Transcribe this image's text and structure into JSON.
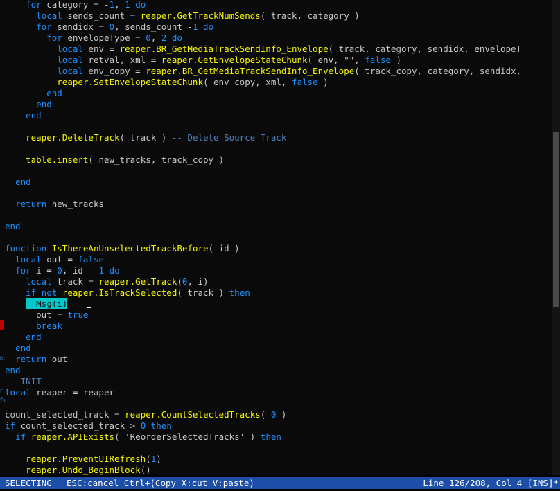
{
  "editor": {
    "lines": [
      [
        [
          "t",
          "    "
        ],
        [
          "k",
          "for"
        ],
        [
          "t",
          " category = -"
        ],
        [
          "n",
          "1"
        ],
        [
          "t",
          ", "
        ],
        [
          "n",
          "1"
        ],
        [
          "t",
          " "
        ],
        [
          "k",
          "do"
        ]
      ],
      [
        [
          "t",
          "      "
        ],
        [
          "k",
          "local"
        ],
        [
          "t",
          " sends_count = "
        ],
        [
          "f",
          "reaper.GetTrackNumSends"
        ],
        [
          "t",
          "( track, category )"
        ]
      ],
      [
        [
          "t",
          "      "
        ],
        [
          "k",
          "for"
        ],
        [
          "t",
          " sendidx = "
        ],
        [
          "n",
          "0"
        ],
        [
          "t",
          ", sends_count -"
        ],
        [
          "n",
          "1"
        ],
        [
          "t",
          " "
        ],
        [
          "k",
          "do"
        ]
      ],
      [
        [
          "t",
          "        "
        ],
        [
          "k",
          "for"
        ],
        [
          "t",
          " envelopeType = "
        ],
        [
          "n",
          "0"
        ],
        [
          "t",
          ", "
        ],
        [
          "n",
          "2"
        ],
        [
          "t",
          " "
        ],
        [
          "k",
          "do"
        ]
      ],
      [
        [
          "t",
          "          "
        ],
        [
          "k",
          "local"
        ],
        [
          "t",
          " env = "
        ],
        [
          "f",
          "reaper.BR_GetMediaTrackSendInfo_Envelope"
        ],
        [
          "t",
          "( track, category, sendidx, envelopeT"
        ]
      ],
      [
        [
          "t",
          "          "
        ],
        [
          "k",
          "local"
        ],
        [
          "t",
          " retval, xml = "
        ],
        [
          "f",
          "reaper.GetEnvelopeStateChunk"
        ],
        [
          "t",
          "( env, "
        ],
        [
          "s",
          "\"\""
        ],
        [
          "t",
          ", "
        ],
        [
          "k",
          "false"
        ],
        [
          "t",
          " )"
        ]
      ],
      [
        [
          "t",
          "          "
        ],
        [
          "k",
          "local"
        ],
        [
          "t",
          " env_copy = "
        ],
        [
          "f",
          "reaper.BR_GetMediaTrackSendInfo_Envelope"
        ],
        [
          "t",
          "( track_copy, category, sendidx,"
        ]
      ],
      [
        [
          "t",
          "          "
        ],
        [
          "f",
          "reaper.SetEnvelopeStateChunk"
        ],
        [
          "t",
          "( env_copy, xml, "
        ],
        [
          "k",
          "false"
        ],
        [
          "t",
          " )"
        ]
      ],
      [
        [
          "t",
          "        "
        ],
        [
          "k",
          "end"
        ]
      ],
      [
        [
          "t",
          "      "
        ],
        [
          "k",
          "end"
        ]
      ],
      [
        [
          "t",
          "    "
        ],
        [
          "k",
          "end"
        ]
      ],
      [],
      [
        [
          "t",
          "    "
        ],
        [
          "f",
          "reaper.DeleteTrack"
        ],
        [
          "t",
          "( track ) "
        ],
        [
          "c",
          "-- Delete Source Track"
        ]
      ],
      [],
      [
        [
          "t",
          "    "
        ],
        [
          "f",
          "table.insert"
        ],
        [
          "t",
          "( new_tracks, track_copy )"
        ]
      ],
      [],
      [
        [
          "t",
          "  "
        ],
        [
          "k",
          "end"
        ]
      ],
      [],
      [
        [
          "t",
          "  "
        ],
        [
          "k",
          "return"
        ],
        [
          "t",
          " new_tracks"
        ]
      ],
      [],
      [
        [
          "k",
          "end"
        ]
      ],
      [],
      [
        [
          "k",
          "function"
        ],
        [
          "t",
          " "
        ],
        [
          "f",
          "IsThereAnUnselectedTrackBefore"
        ],
        [
          "t",
          "( id )"
        ]
      ],
      [
        [
          "t",
          "  "
        ],
        [
          "k",
          "local"
        ],
        [
          "t",
          " out = "
        ],
        [
          "k",
          "false"
        ]
      ],
      [
        [
          "t",
          "  "
        ],
        [
          "k",
          "for"
        ],
        [
          "t",
          " i = "
        ],
        [
          "n",
          "0"
        ],
        [
          "t",
          ", id - "
        ],
        [
          "n",
          "1"
        ],
        [
          "t",
          " "
        ],
        [
          "k",
          "do"
        ]
      ],
      [
        [
          "t",
          "    "
        ],
        [
          "k",
          "local"
        ],
        [
          "t",
          " track = "
        ],
        [
          "f",
          "reaper.GetTrack"
        ],
        [
          "t",
          "("
        ],
        [
          "n",
          "0"
        ],
        [
          "t",
          ", i)"
        ]
      ],
      [
        [
          "t",
          "    "
        ],
        [
          "k",
          "if not"
        ],
        [
          "t",
          " "
        ],
        [
          "f",
          "reaper.IsTrackSelected"
        ],
        [
          "t",
          "( track ) "
        ],
        [
          "k",
          "then"
        ]
      ],
      [
        [
          "t",
          "    "
        ],
        [
          "sel",
          "  Msg(i)"
        ]
      ],
      [
        [
          "t",
          "      out = "
        ],
        [
          "k",
          "true"
        ]
      ],
      [
        [
          "t",
          "      "
        ],
        [
          "k",
          "break"
        ]
      ],
      [
        [
          "t",
          "    "
        ],
        [
          "k",
          "end"
        ]
      ],
      [
        [
          "t",
          "  "
        ],
        [
          "k",
          "end"
        ]
      ],
      [
        [
          "t",
          "  "
        ],
        [
          "k",
          "return"
        ],
        [
          "t",
          " out"
        ]
      ],
      [
        [
          "k",
          "end"
        ]
      ],
      [
        [
          "c",
          "-- INIT"
        ]
      ],
      [
        [
          "k",
          "local"
        ],
        [
          "t",
          " reaper = reaper"
        ]
      ],
      [],
      [
        [
          "t",
          "count_selected_track = "
        ],
        [
          "f",
          "reaper.CountSelectedTracks"
        ],
        [
          "t",
          "( "
        ],
        [
          "n",
          "0"
        ],
        [
          "t",
          " )"
        ]
      ],
      [
        [
          "k",
          "if"
        ],
        [
          "t",
          " count_selected_track > "
        ],
        [
          "n",
          "0"
        ],
        [
          "t",
          " "
        ],
        [
          "k",
          "then"
        ]
      ],
      [
        [
          "t",
          "  "
        ],
        [
          "k",
          "if"
        ],
        [
          "t",
          " "
        ],
        [
          "f",
          "reaper.APIExists"
        ],
        [
          "t",
          "( 'ReorderSelectedTracks' ) "
        ],
        [
          "k",
          "then"
        ]
      ],
      [],
      [
        [
          "t",
          "    "
        ],
        [
          "f",
          "reaper.PreventUIRefresh"
        ],
        [
          "t",
          "("
        ],
        [
          "n",
          "1"
        ],
        [
          "t",
          ")"
        ]
      ],
      [
        [
          "t",
          "    "
        ],
        [
          "f",
          "reaper.Undo_BeginBlock"
        ],
        [
          "t",
          "()"
        ]
      ]
    ],
    "gutter_fragments": [
      "er",
      "r'",
      "fo"
    ],
    "scroll_fraction": 0.44
  },
  "statusbar": {
    "mode": "SELECTING",
    "hint": "ESC:cancel Ctrl+(Copy X:cut V:paste)",
    "position": "Line 126/208, Col 4 [INS]*"
  },
  "colors": {
    "background": "#0a0a0a",
    "text": "#c8c8c8",
    "keyword": "#1e90ff",
    "function": "#f5f500",
    "comment": "#4f7fb8",
    "selection": "#00c8c8",
    "statusbar": "#1d4fa8"
  }
}
